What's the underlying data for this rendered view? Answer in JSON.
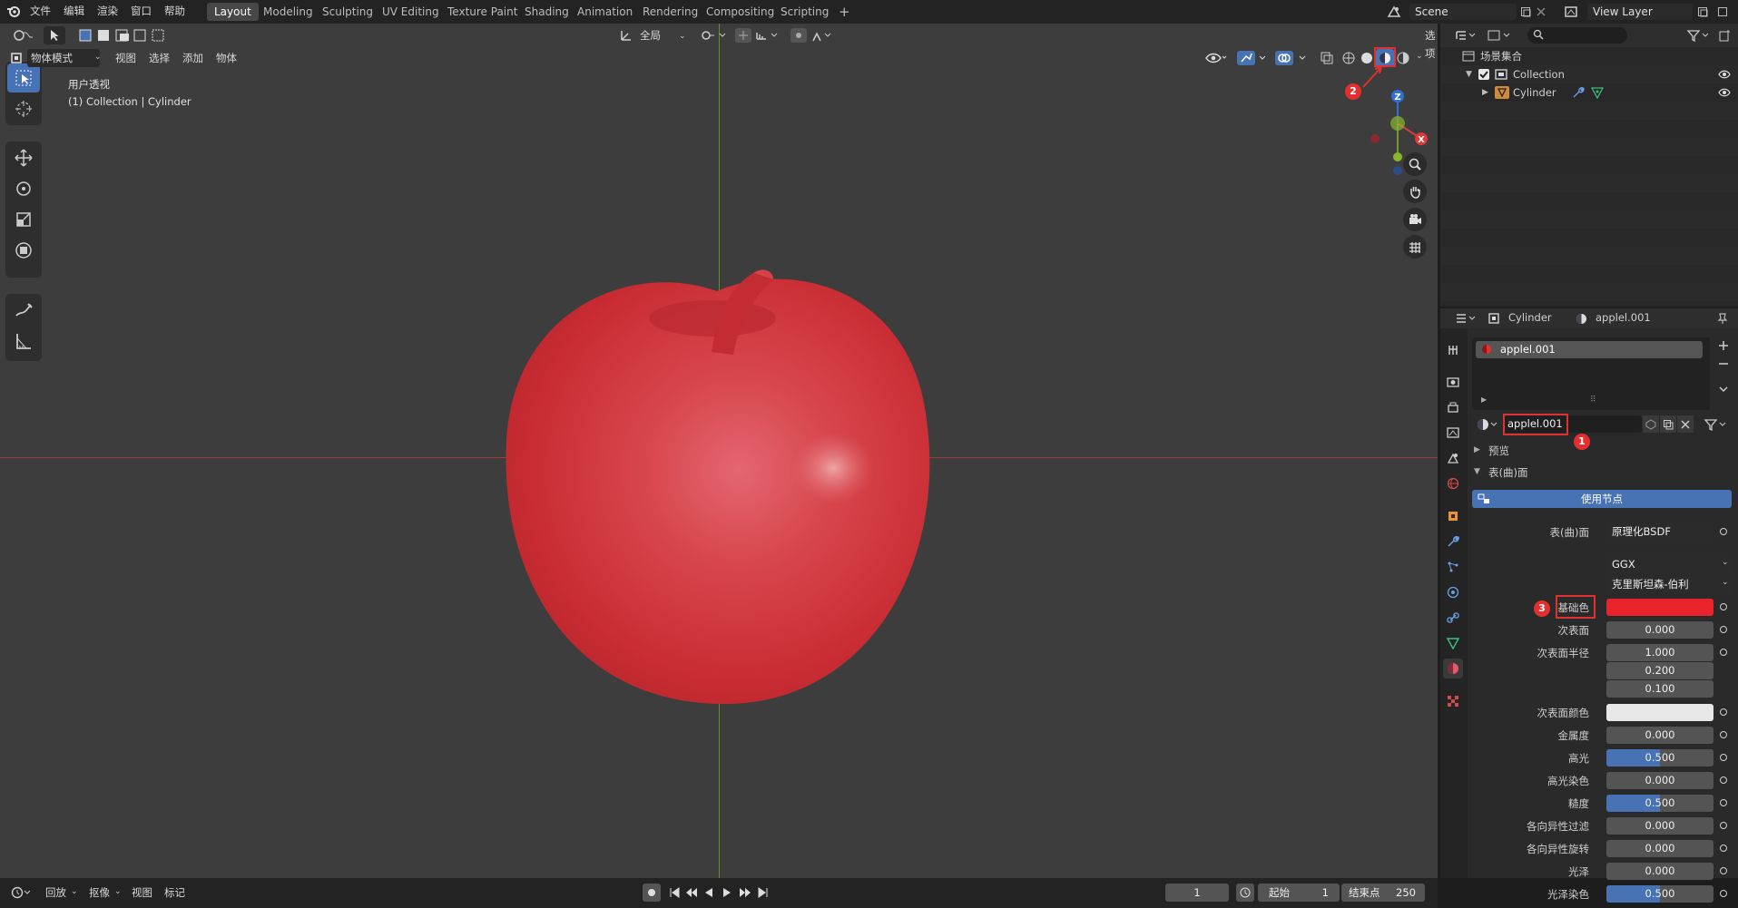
{
  "topbar": {
    "menus": [
      "文件",
      "编辑",
      "渲染",
      "窗口",
      "帮助"
    ],
    "workspaces": [
      "Layout",
      "Modeling",
      "Sculpting",
      "UV Editing",
      "Texture Paint",
      "Shading",
      "Animation",
      "Rendering",
      "Compositing",
      "Scripting"
    ],
    "active_workspace": "Layout",
    "add_tab": "+",
    "scene": "Scene",
    "view_layer": "View Layer"
  },
  "viewport": {
    "mode": "物体模式",
    "menus": [
      "视图",
      "选择",
      "添加",
      "物体"
    ],
    "transform_orientation": "全局",
    "options": "选项",
    "overlay_title": "用户透视",
    "overlay_subtitle": "(1) Collection | Cylinder",
    "axis_labels": {
      "z": "Z",
      "x": "X"
    }
  },
  "outliner": {
    "root": "场景集合",
    "collection": "Collection",
    "object": "Cylinder"
  },
  "properties": {
    "object_name": "Cylinder",
    "material_name": "applel.001",
    "slot_name": "applel.001",
    "material_field": "applel.001",
    "preview_label": "预览",
    "surface_label": "表(曲)面",
    "use_nodes": "使用节点",
    "surface_row_label": "表(曲)面",
    "shader": "原理化BSDF",
    "distribution": "GGX",
    "subsurface_method": "克里斯坦森-伯利",
    "base_color_label": "基础色",
    "base_color": "#e8232b",
    "params": [
      {
        "label": "次表面",
        "value": "0.000",
        "fill": 0
      },
      {
        "label": "次表面半径",
        "value": "1.000",
        "fill": 0
      },
      {
        "label": "",
        "value": "0.200",
        "fill": 0
      },
      {
        "label": "",
        "value": "0.100",
        "fill": 0
      },
      {
        "label": "次表面颜色",
        "value": "",
        "fill": 0
      },
      {
        "label": "金属度",
        "value": "0.000",
        "fill": 0
      },
      {
        "label": "高光",
        "value": "0.500",
        "fill": 0.5
      },
      {
        "label": "高光染色",
        "value": "0.000",
        "fill": 0
      },
      {
        "label": "糙度",
        "value": "0.500",
        "fill": 0.5
      },
      {
        "label": "各向异性过滤",
        "value": "0.000",
        "fill": 0
      },
      {
        "label": "各向异性旋转",
        "value": "0.000",
        "fill": 0
      },
      {
        "label": "光泽",
        "value": "0.000",
        "fill": 0
      },
      {
        "label": "光泽染色",
        "value": "0.500",
        "fill": 0.5
      }
    ]
  },
  "timeline": {
    "menus": [
      "回放",
      "抠像",
      "视图",
      "标记"
    ],
    "current_frame": "1",
    "start_label": "起始",
    "start": "1",
    "end_label": "结束点",
    "end": "250"
  },
  "annotations": [
    "1",
    "2",
    "3"
  ],
  "colors": {
    "accent": "#4772b3",
    "annotation": "#e03030",
    "apple": "#d93a40"
  }
}
